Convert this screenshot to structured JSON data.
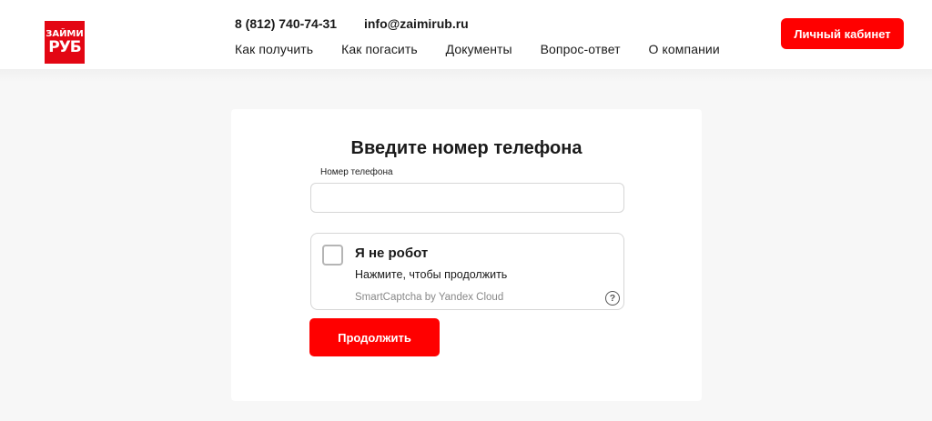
{
  "brand": {
    "logo_line1": "ЗАЙМИ",
    "logo_line2": "РУБ",
    "accent_color": "#ff0000"
  },
  "header": {
    "phone": "8 (812) 740-74-31",
    "email": "info@zaimirub.ru",
    "nav": [
      {
        "label": "Как получить"
      },
      {
        "label": "Как погасить"
      },
      {
        "label": "Документы"
      },
      {
        "label": "Вопрос-ответ"
      },
      {
        "label": "О компании"
      }
    ],
    "cabinet_label": "Личный кабинет"
  },
  "form": {
    "title": "Введите номер телефона",
    "phone_label": "Номер телефона",
    "phone_value": "",
    "captcha": {
      "checkbox_label": "Я не робот",
      "hint": "Нажмите, чтобы продолжить",
      "brand": "SmartCaptcha by Yandex Cloud",
      "help_icon": "?"
    },
    "submit_label": "Продолжить"
  }
}
